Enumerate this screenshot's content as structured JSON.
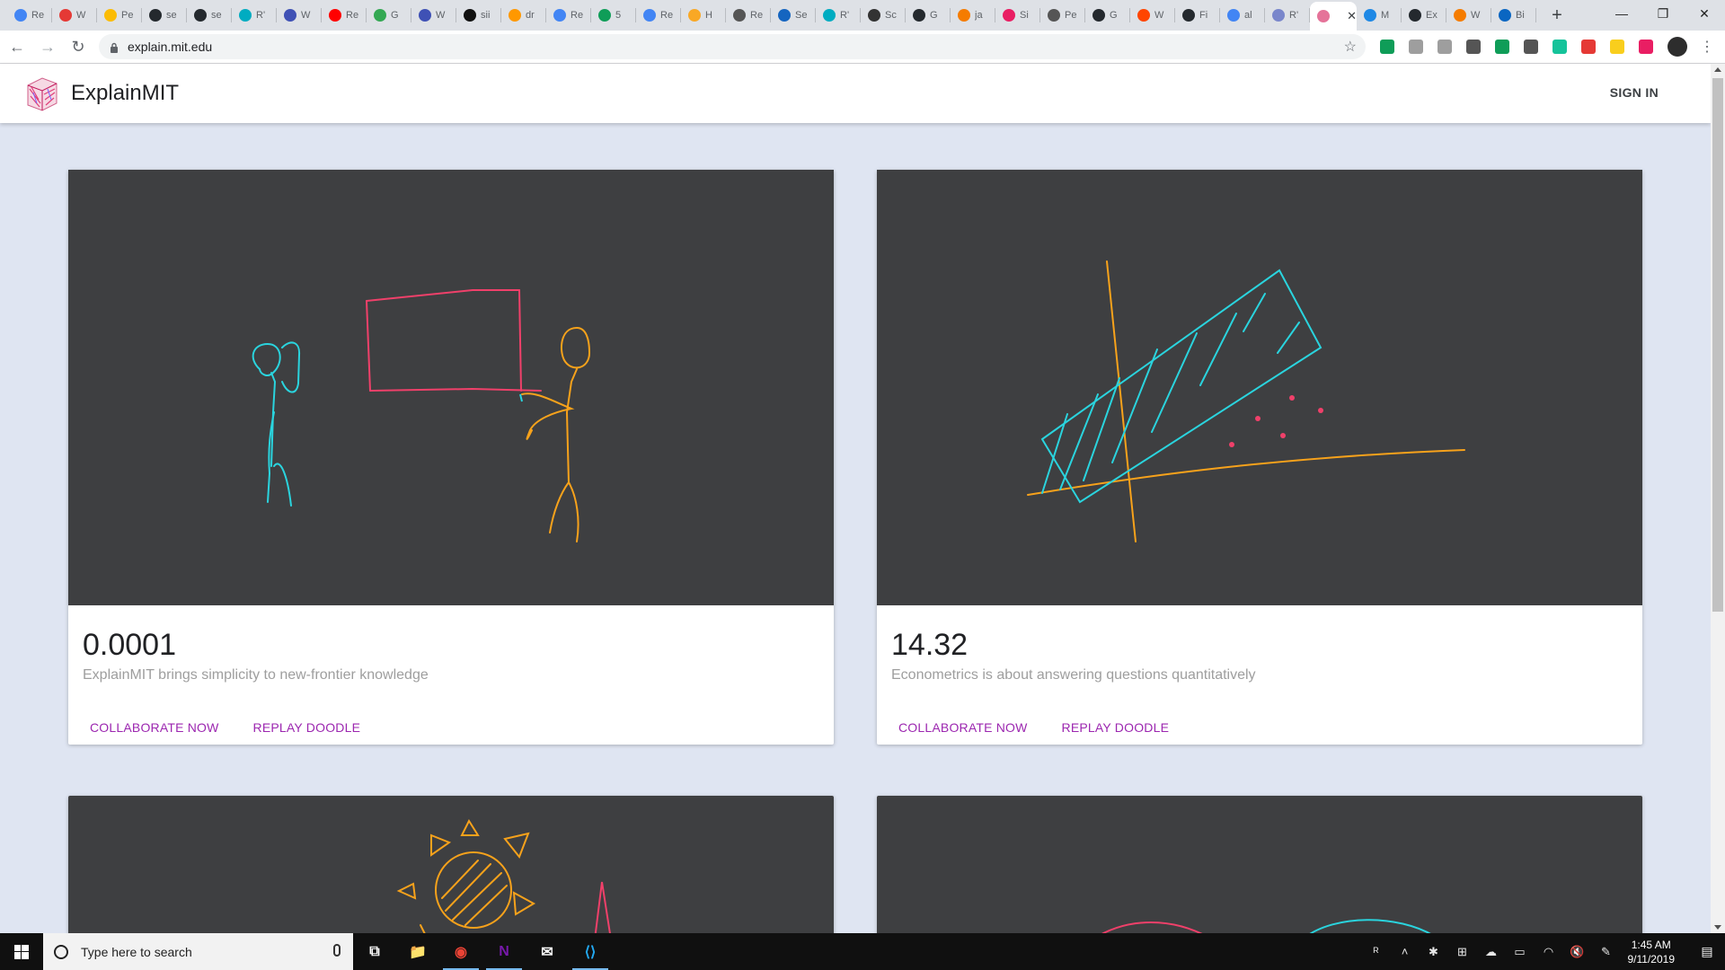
{
  "browser": {
    "tabs": [
      {
        "label": "Re",
        "color": "#4285f4"
      },
      {
        "label": "W",
        "color": "#e53935"
      },
      {
        "label": "Pe",
        "color": "#fbbc05"
      },
      {
        "label": "se",
        "color": "#24292e"
      },
      {
        "label": "se",
        "color": "#24292e"
      },
      {
        "label": "R'",
        "color": "#00acc1"
      },
      {
        "label": "W",
        "color": "#3f51b5"
      },
      {
        "label": "Re",
        "color": "#ff0000"
      },
      {
        "label": "G",
        "color": "#34a853"
      },
      {
        "label": "W",
        "color": "#3f51b5"
      },
      {
        "label": "sii",
        "color": "#111111"
      },
      {
        "label": "dr",
        "color": "#ff9800"
      },
      {
        "label": "Re",
        "color": "#4285f4"
      },
      {
        "label": "5",
        "color": "#0f9d58"
      },
      {
        "label": "Re",
        "color": "#4285f4"
      },
      {
        "label": "H",
        "color": "#f9a825"
      },
      {
        "label": "Re",
        "color": "#555555"
      },
      {
        "label": "Se",
        "color": "#1565c0"
      },
      {
        "label": "R'",
        "color": "#00acc1"
      },
      {
        "label": "Sc",
        "color": "#333333"
      },
      {
        "label": "G",
        "color": "#24292e"
      },
      {
        "label": "ja",
        "color": "#f57c00"
      },
      {
        "label": "Si",
        "color": "#e91e63"
      },
      {
        "label": "Pe",
        "color": "#555555"
      },
      {
        "label": "G",
        "color": "#24292e"
      },
      {
        "label": "W",
        "color": "#ff4500"
      },
      {
        "label": "Fi",
        "color": "#24292e"
      },
      {
        "label": "al",
        "color": "#4285f4"
      },
      {
        "label": "R'",
        "color": "#7986cb"
      },
      {
        "label": "",
        "color": "#e57399",
        "active": true,
        "close": "✕"
      },
      {
        "label": "M",
        "color": "#1e88e5"
      },
      {
        "label": "Ex",
        "color": "#24292e"
      },
      {
        "label": "W",
        "color": "#f57c00"
      },
      {
        "label": "Bi",
        "color": "#0a66c2"
      }
    ],
    "new_tab": "+",
    "window_controls": {
      "minimize": "—",
      "maximize": "❐",
      "close": "✕"
    },
    "nav": {
      "back": "←",
      "forward": "→",
      "reload": "↻"
    },
    "url": "explain.mit.edu",
    "bookmark": "☆",
    "extensions": [
      "#0f9d58",
      "#9e9e9e",
      "#9e9e9e",
      "#555555",
      "#0f9d58",
      "#555555",
      "#15c39a",
      "#e53935",
      "#f9ce1d",
      "#e91e63"
    ],
    "menu": "⋮"
  },
  "app": {
    "brand": "ExplainMIT",
    "sign_in": "SIGN IN",
    "colors": {
      "accent": "#9c27b0",
      "canvas": "#3e3f41",
      "page_bg": "#dfe5f2",
      "cyan": "#2ad4de",
      "orange": "#f7a21b",
      "pink": "#f0406a"
    }
  },
  "cards": [
    {
      "title": "0.0001",
      "description": "ExplainMIT brings simplicity to new-frontier knowledge",
      "actions": [
        "COLLABORATE NOW",
        "REPLAY DOODLE"
      ]
    },
    {
      "title": "14.32",
      "description": "Econometrics is about answering questions quantitatively",
      "actions": [
        "COLLABORATE NOW",
        "REPLAY DOODLE"
      ]
    }
  ],
  "taskbar": {
    "search_placeholder": "Type here to search",
    "apps": [
      {
        "name": "task-view",
        "glyph": "⧉"
      },
      {
        "name": "file-explorer",
        "glyph": "📁"
      },
      {
        "name": "chrome",
        "glyph": "◉"
      },
      {
        "name": "onenote",
        "glyph": "N"
      },
      {
        "name": "mail",
        "glyph": "✉"
      },
      {
        "name": "vscode",
        "glyph": "⟨⟩"
      }
    ],
    "tray": [
      "ᴿ",
      "˄",
      "✱",
      "⊞",
      "☁",
      "▭",
      "◠",
      "🔇",
      "✎"
    ],
    "time": "1:45 AM",
    "date": "9/11/2019"
  }
}
